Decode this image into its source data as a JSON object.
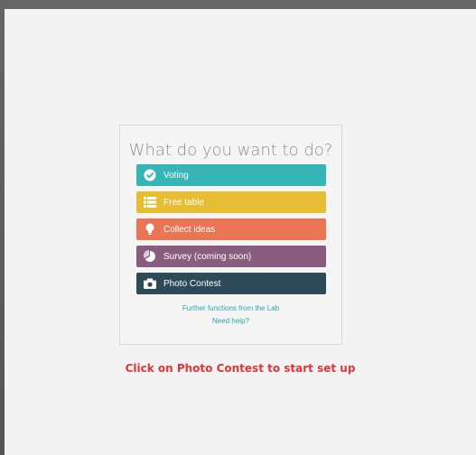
{
  "dialog": {
    "title": "What do you want to do?",
    "options": [
      {
        "label": "Voting",
        "icon": "check-circle-icon",
        "color": "#35b5b5"
      },
      {
        "label": "Free table",
        "icon": "table-icon",
        "color": "#e7bd33"
      },
      {
        "label": "Collect ideas",
        "icon": "lightbulb-icon",
        "color": "#ea7555"
      },
      {
        "label": "Survey (coming soon)",
        "icon": "chart-icon",
        "color": "#8a5d80"
      },
      {
        "label": "Photo Contest",
        "icon": "camera-icon",
        "color": "#2d4a59"
      }
    ],
    "links": {
      "further": "Further functions from the Lab",
      "help": "Need help?"
    }
  },
  "instruction": "Click on Photo Contest to start set up"
}
